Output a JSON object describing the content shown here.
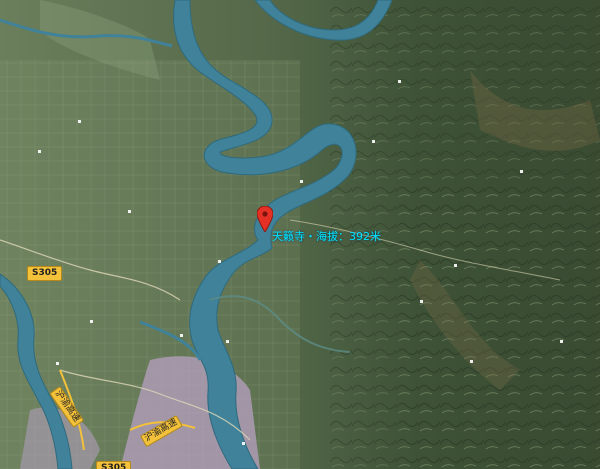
{
  "map": {
    "view": "satellite",
    "colors": {
      "terrain_dark": "#3c4f35",
      "terrain_light": "#6f8460",
      "river": "#3f8299",
      "urban": "#b7a0c2",
      "pin": "#e53125",
      "highlight_text": "#00e5ff",
      "shield": "#f3c13a"
    },
    "marker": {
      "icon": "map-pin-icon",
      "label": "天籁寺・海拔：392米"
    },
    "road_labels": {
      "s305": "S305",
      "bottom_shield": "S305",
      "road_a": "沪渝高速",
      "road_b": "沪渝高速"
    }
  }
}
